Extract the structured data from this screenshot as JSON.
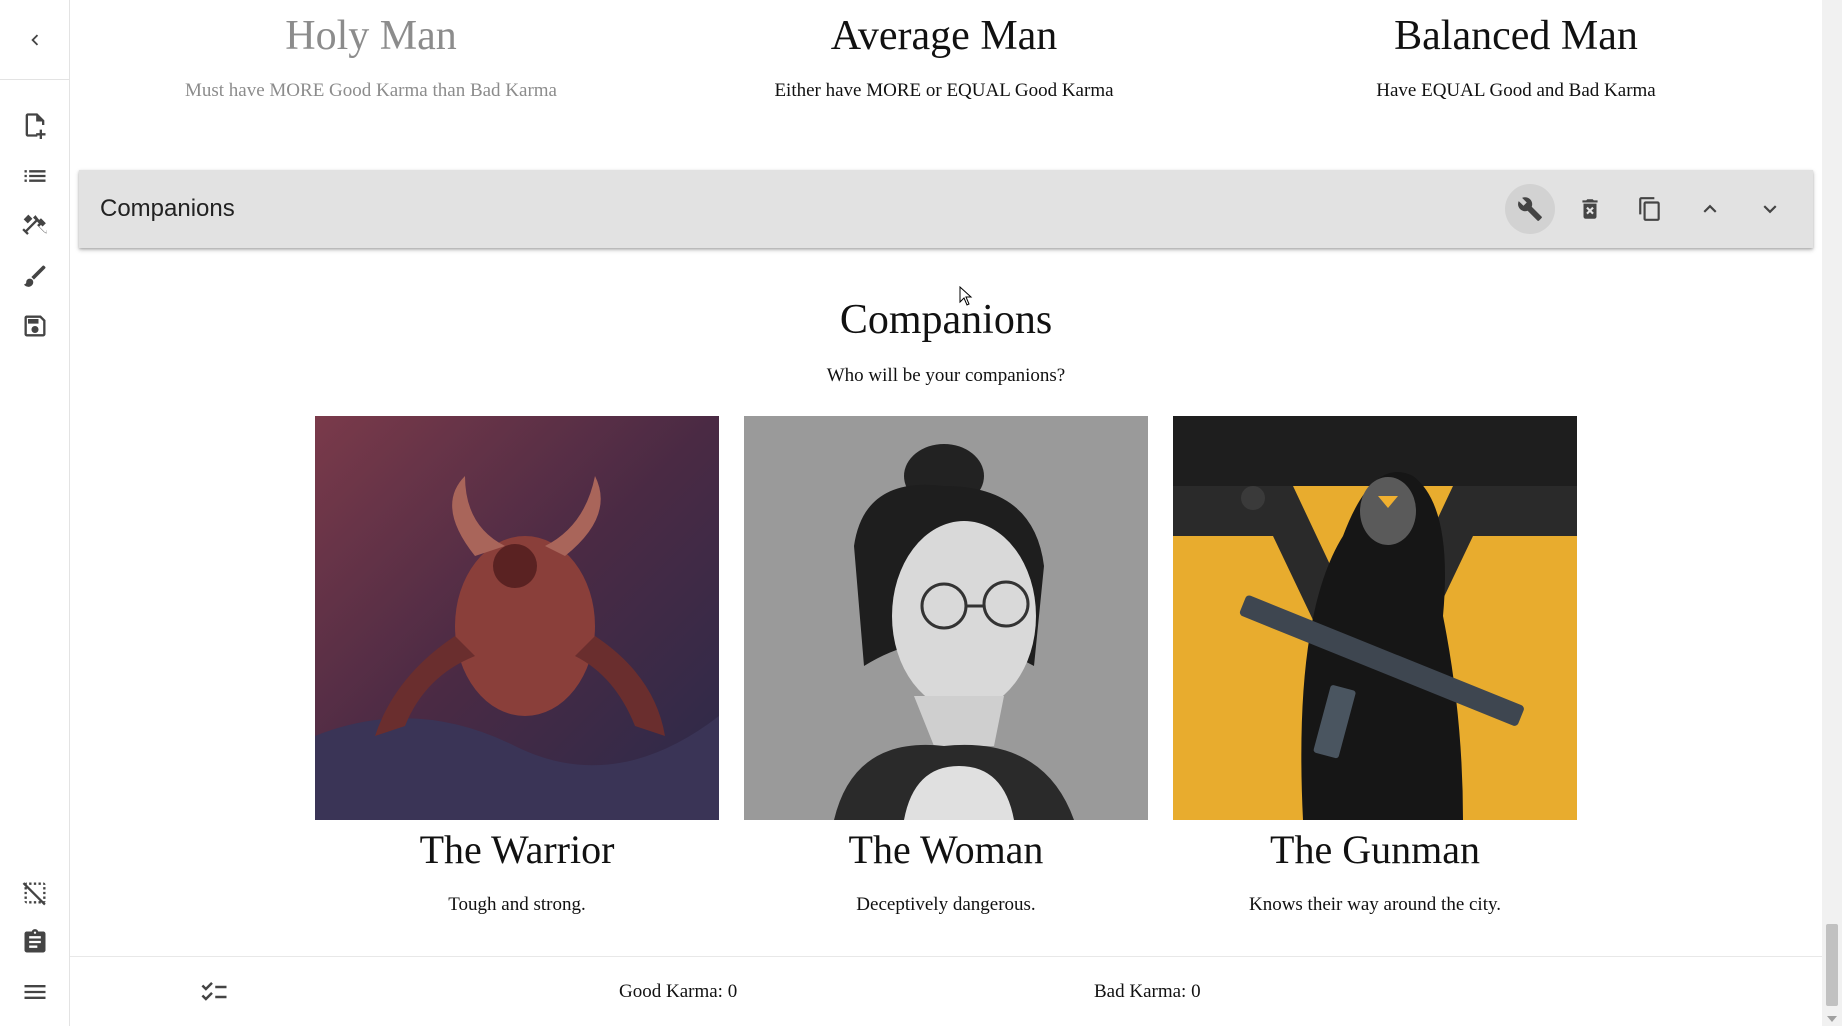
{
  "choices": [
    {
      "title": "Holy Man",
      "desc": "Must have MORE Good Karma than Bad Karma",
      "disabled": true
    },
    {
      "title": "Average Man",
      "desc": "Either have MORE or EQUAL Good Karma"
    },
    {
      "title": "Balanced Man",
      "desc": "Have EQUAL Good and Bad Karma"
    }
  ],
  "row_editor": {
    "title": "Companions",
    "tools": [
      "wrench-icon",
      "delete-icon",
      "copy-icon",
      "chevron-up-icon",
      "chevron-down-icon"
    ]
  },
  "section": {
    "title": "Companions",
    "desc": "Who will be your companions?"
  },
  "cards": [
    {
      "title": "The Warrior",
      "desc": "Tough and strong."
    },
    {
      "title": "The Woman",
      "desc": "Deceptively dangerous."
    },
    {
      "title": "The Gunman",
      "desc": "Knows their way around the city."
    }
  ],
  "bottom_bar": {
    "good_karma": "Good Karma: 0",
    "bad_karma": "Bad Karma: 0"
  },
  "sidebar": {
    "top_icons": [
      "back-icon",
      "new-file-icon",
      "list-icon",
      "tools-icon",
      "brush-icon",
      "save-icon"
    ],
    "bottom_icons": [
      "selection-off-icon",
      "clipboard-icon",
      "menu-icon"
    ]
  }
}
